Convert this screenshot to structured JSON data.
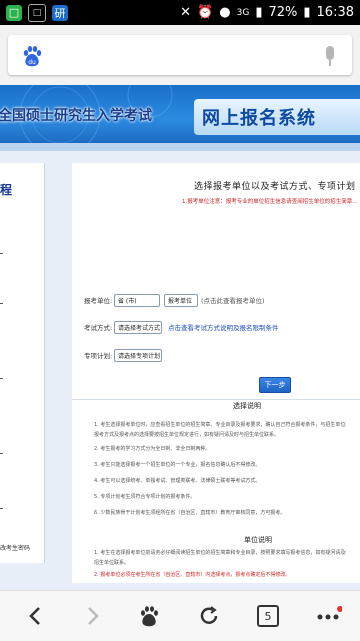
{
  "status_bar": {
    "app_badge": "研",
    "battery": "72%",
    "time": "16:38",
    "network": "3G"
  },
  "browser": {
    "logo_text": "du",
    "tab_count": "5"
  },
  "banner": {
    "left_title": "全国硕士研究生入学考试",
    "right_title": "网上报名系统"
  },
  "sidebar": {
    "title": "程",
    "footer": "改考生密码"
  },
  "content": {
    "title": "选择报考单位以及考试方式、专项计划",
    "warning": "1.报考单位注意：报考专业的单位招生信息请查阅招生单位的招生简章...",
    "form": {
      "unit_label": "报考单位:",
      "unit_value": "省 (市)",
      "unit_value2": "报考单位",
      "unit_hint": "(点击此查看报考单位)",
      "method_label": "考试方式:",
      "method_value": "请选择考试方式",
      "method_link": "点击查看考试方式说明及报名限制条件",
      "plan_label": "专项计划:",
      "plan_value": "请选择专项计划"
    },
    "next_button": "下一步",
    "section1_title": "选择说明",
    "section2_title": "单位说明",
    "lines1": [
      "1. 考生选择报考单位时，应查看招生单位的招生简章、专业目录及报考要求，确认自己符合报考条件，与招生单位联系...",
      "   报考方式及报考点的选择要按招生单位规定进行，如有疑问请及时与招生单位联系。",
      "2. 考生报考的学习方式分为全日制、非全日制两种。",
      "3. 考生只能选择报考一个招生单位的一个专业，报名信息确认后不得修改。",
      "4. 考生可以选择统考、单独考试、管理类联考、法律硕士联考等考试方式。",
      "5. 专项计划考生须符合专项计划的报考条件。",
      "6. 少数民族骨干计划考生须经所在省（自治区、直辖市）教育厅审核同意，方可报考。"
    ],
    "lines2": [
      "1. 考生在选择报考单位前请务必仔细阅读招生单位的招生简章和专业目录，按照要求填写报考信息，如有疑问请及时与",
      "   招生单位联系。",
      "2. 报考单位必须在考生所在省（自治区、直辖市）内选择考点，报考点确定后不得修改。",
      "3. 考生要按照规定时间到报考点进行现场确认，不按规定进行现场确认的，报名无效。",
      "4. 考生在报名期间可以自行修改网上报名信息，报名截止后不得修改。",
      "5. 考生只能选择一个报考点进行网上报名。"
    ]
  },
  "colors": {
    "banner_blue": "#1a6fc9",
    "link_blue": "#1a4fc4",
    "warn_red": "#d02424"
  },
  "icons": [
    "wechat-icon",
    "mute-icon",
    "alarm-icon",
    "wifi-icon",
    "signal-icon",
    "battery-icon",
    "baidu-logo-icon",
    "mic-icon",
    "back-icon",
    "forward-icon",
    "home-icon",
    "refresh-icon",
    "tabs-icon",
    "menu-icon"
  ]
}
